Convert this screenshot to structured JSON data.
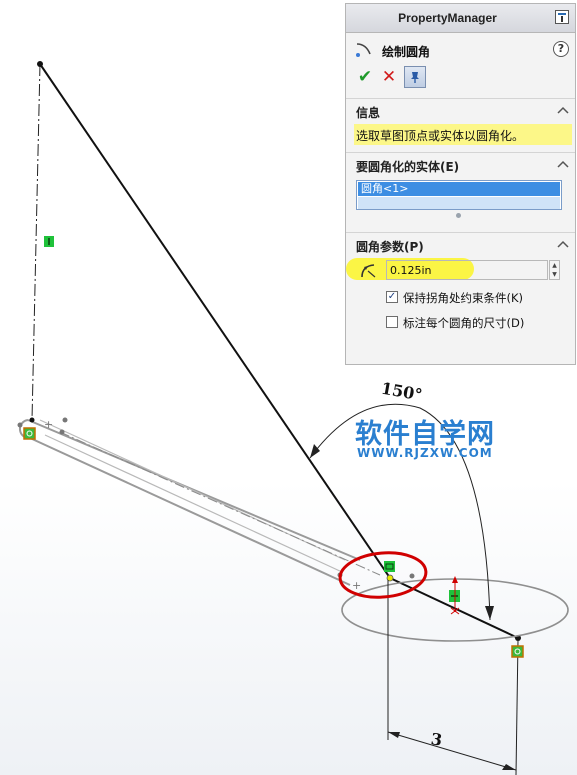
{
  "property_manager": {
    "title": "PropertyManager",
    "feature_name": "绘制圆角",
    "help_symbol": "?",
    "ok_symbol": "✔",
    "cancel_symbol": "✕",
    "keep_visible_symbol": "📌",
    "sections": {
      "message": {
        "title": "信息",
        "text": "选取草图顶点或实体以圆角化。"
      },
      "entities": {
        "title": "要圆角化的实体(E)",
        "items": [
          "圆角<1>"
        ]
      },
      "parameters": {
        "title": "圆角参数(P)",
        "radius_value": "0.125in",
        "checkboxes": [
          {
            "label": "保持拐角处约束条件(K)",
            "checked": true
          },
          {
            "label": "标注每个圆角的尺寸(D)",
            "checked": false
          }
        ]
      }
    }
  },
  "sketch": {
    "angle_dimension": "150°",
    "length_dimension": "3",
    "relation_labels": {
      "vertical": "I",
      "coincident": "0",
      "horizontal": "—"
    }
  },
  "watermark": {
    "title": "软件自学网",
    "url": "WWW.RJZXW.COM"
  },
  "colors": {
    "highlight_yellow": "#fbf545",
    "selection_blue": "#3d8ee3",
    "annotation_red": "#d00000",
    "relation_green": "#1fc23a",
    "watermark_blue": "#2a7fd0"
  }
}
